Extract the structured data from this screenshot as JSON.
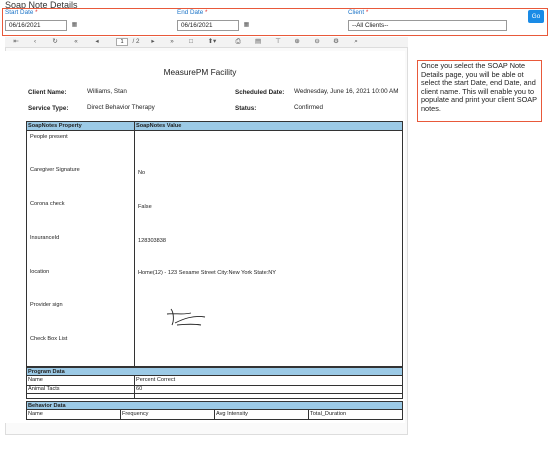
{
  "page": {
    "title": "Soap Note Details"
  },
  "filters": {
    "start_date_label": "Start Date",
    "end_date_label": "End Date",
    "client_label": "Client",
    "required_mark": "*",
    "start_date_value": "06/16/2021",
    "end_date_value": "06/16/2021",
    "client_value": "--All Clients--",
    "go_label": "Go"
  },
  "toolbar": {
    "first_icon": "⇤",
    "prev_icon": "‹",
    "refresh_icon": "↻",
    "first_page_icon": "«",
    "prev_page_icon": "◂",
    "current_page": "1",
    "page_total": "/ 2",
    "next_page_icon": "▸",
    "last_page_icon": "»",
    "page_view_icon": "□",
    "export_icon": "⬆▾",
    "print_icon": "⎙",
    "doc_icon": "▤",
    "filter_icon": "⊤",
    "zoom_in_icon": "⊕",
    "zoom_out_icon": "⊖",
    "settings_icon": "⚙",
    "search_icon": "⌕"
  },
  "report": {
    "facility": "MeasurePM Facility",
    "client_name_label": "Client Name:",
    "client_name": "Williams, Stan",
    "scheduled_date_label": "Scheduled Date:",
    "scheduled_date": "Wednesday, June 16, 2021 10:00 AM",
    "service_type_label": "Service Type:",
    "service_type": "Direct Behavior Therapy",
    "status_label": "Status:",
    "status": "Confirmed",
    "soap_property_header": "SoapNotes Property",
    "soap_value_header": "SoapNotes Value",
    "properties": [
      {
        "name": "People present",
        "value": ""
      },
      {
        "name": "Caregiver Signature",
        "value": "No"
      },
      {
        "name": "Corona check",
        "value": "False"
      },
      {
        "name": "InsuranceId",
        "value": "128303838"
      },
      {
        "name": "location",
        "value": "Home(12) - 123 Sesame Street   City:New York State:NY"
      },
      {
        "name": "Provider sign",
        "value": ""
      },
      {
        "name": "Check Box List",
        "value": ""
      }
    ],
    "program_data_header": "Program Data",
    "program_cols": [
      "Name",
      "Percent Correct"
    ],
    "program_row": [
      "Animal Tacts",
      "60"
    ],
    "behavior_data_header": "Behavior Data",
    "behavior_cols": [
      "Name",
      "Frequency",
      "Avg Intensity",
      "Total_Duration"
    ]
  },
  "callout": {
    "text": "Once you select the SOAP Note Details page, you will be able ot select the start Date, end Date, and client name.  This will enable you to populate and print your client SOAP notes."
  }
}
